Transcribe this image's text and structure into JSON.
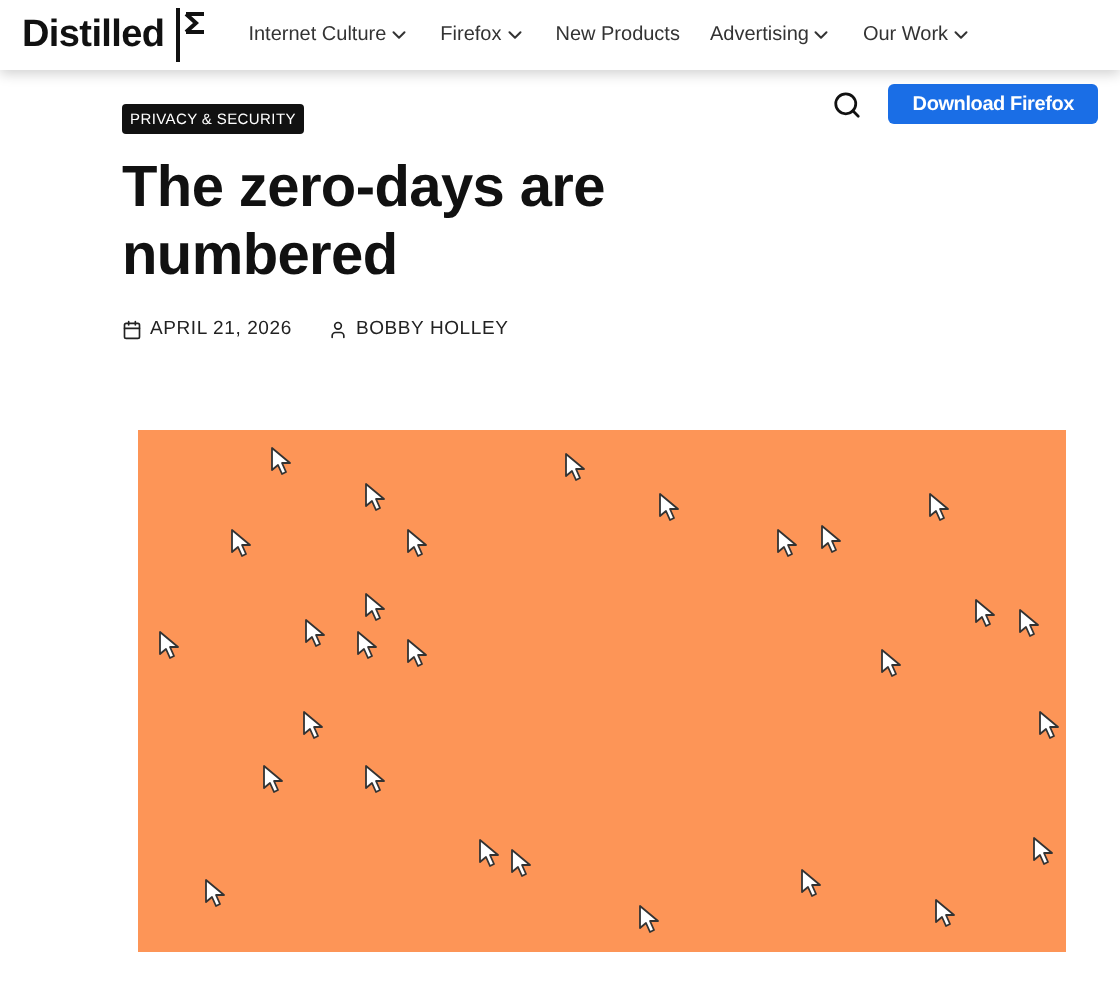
{
  "header": {
    "logo": "Distilled",
    "nav": [
      {
        "label": "Internet Culture",
        "dropdown": true
      },
      {
        "label": "Firefox",
        "dropdown": true
      },
      {
        "label": "New Products",
        "dropdown": false
      },
      {
        "label": "Advertising",
        "dropdown": true
      },
      {
        "label": "Our Work",
        "dropdown": true
      }
    ]
  },
  "toolbar": {
    "button": "Download Firefox"
  },
  "article": {
    "category": "PRIVACY & SECURITY",
    "title": "The zero-days are numbered",
    "date": "APRIL 21, 2026",
    "author": "BOBBY HOLLEY"
  }
}
